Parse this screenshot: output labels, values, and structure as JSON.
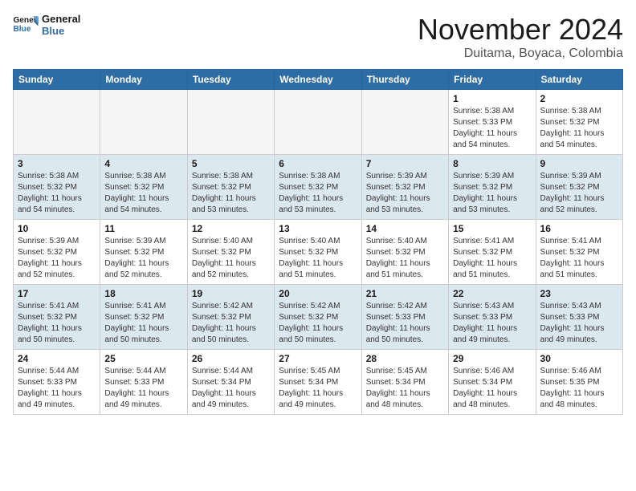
{
  "header": {
    "logo_line1": "General",
    "logo_line2": "Blue",
    "month": "November 2024",
    "location": "Duitama, Boyaca, Colombia"
  },
  "weekdays": [
    "Sunday",
    "Monday",
    "Tuesday",
    "Wednesday",
    "Thursday",
    "Friday",
    "Saturday"
  ],
  "weeks": [
    [
      {
        "day": "",
        "info": ""
      },
      {
        "day": "",
        "info": ""
      },
      {
        "day": "",
        "info": ""
      },
      {
        "day": "",
        "info": ""
      },
      {
        "day": "",
        "info": ""
      },
      {
        "day": "1",
        "info": "Sunrise: 5:38 AM\nSunset: 5:33 PM\nDaylight: 11 hours\nand 54 minutes."
      },
      {
        "day": "2",
        "info": "Sunrise: 5:38 AM\nSunset: 5:32 PM\nDaylight: 11 hours\nand 54 minutes."
      }
    ],
    [
      {
        "day": "3",
        "info": "Sunrise: 5:38 AM\nSunset: 5:32 PM\nDaylight: 11 hours\nand 54 minutes."
      },
      {
        "day": "4",
        "info": "Sunrise: 5:38 AM\nSunset: 5:32 PM\nDaylight: 11 hours\nand 54 minutes."
      },
      {
        "day": "5",
        "info": "Sunrise: 5:38 AM\nSunset: 5:32 PM\nDaylight: 11 hours\nand 53 minutes."
      },
      {
        "day": "6",
        "info": "Sunrise: 5:38 AM\nSunset: 5:32 PM\nDaylight: 11 hours\nand 53 minutes."
      },
      {
        "day": "7",
        "info": "Sunrise: 5:39 AM\nSunset: 5:32 PM\nDaylight: 11 hours\nand 53 minutes."
      },
      {
        "day": "8",
        "info": "Sunrise: 5:39 AM\nSunset: 5:32 PM\nDaylight: 11 hours\nand 53 minutes."
      },
      {
        "day": "9",
        "info": "Sunrise: 5:39 AM\nSunset: 5:32 PM\nDaylight: 11 hours\nand 52 minutes."
      }
    ],
    [
      {
        "day": "10",
        "info": "Sunrise: 5:39 AM\nSunset: 5:32 PM\nDaylight: 11 hours\nand 52 minutes."
      },
      {
        "day": "11",
        "info": "Sunrise: 5:39 AM\nSunset: 5:32 PM\nDaylight: 11 hours\nand 52 minutes."
      },
      {
        "day": "12",
        "info": "Sunrise: 5:40 AM\nSunset: 5:32 PM\nDaylight: 11 hours\nand 52 minutes."
      },
      {
        "day": "13",
        "info": "Sunrise: 5:40 AM\nSunset: 5:32 PM\nDaylight: 11 hours\nand 51 minutes."
      },
      {
        "day": "14",
        "info": "Sunrise: 5:40 AM\nSunset: 5:32 PM\nDaylight: 11 hours\nand 51 minutes."
      },
      {
        "day": "15",
        "info": "Sunrise: 5:41 AM\nSunset: 5:32 PM\nDaylight: 11 hours\nand 51 minutes."
      },
      {
        "day": "16",
        "info": "Sunrise: 5:41 AM\nSunset: 5:32 PM\nDaylight: 11 hours\nand 51 minutes."
      }
    ],
    [
      {
        "day": "17",
        "info": "Sunrise: 5:41 AM\nSunset: 5:32 PM\nDaylight: 11 hours\nand 50 minutes."
      },
      {
        "day": "18",
        "info": "Sunrise: 5:41 AM\nSunset: 5:32 PM\nDaylight: 11 hours\nand 50 minutes."
      },
      {
        "day": "19",
        "info": "Sunrise: 5:42 AM\nSunset: 5:32 PM\nDaylight: 11 hours\nand 50 minutes."
      },
      {
        "day": "20",
        "info": "Sunrise: 5:42 AM\nSunset: 5:32 PM\nDaylight: 11 hours\nand 50 minutes."
      },
      {
        "day": "21",
        "info": "Sunrise: 5:42 AM\nSunset: 5:33 PM\nDaylight: 11 hours\nand 50 minutes."
      },
      {
        "day": "22",
        "info": "Sunrise: 5:43 AM\nSunset: 5:33 PM\nDaylight: 11 hours\nand 49 minutes."
      },
      {
        "day": "23",
        "info": "Sunrise: 5:43 AM\nSunset: 5:33 PM\nDaylight: 11 hours\nand 49 minutes."
      }
    ],
    [
      {
        "day": "24",
        "info": "Sunrise: 5:44 AM\nSunset: 5:33 PM\nDaylight: 11 hours\nand 49 minutes."
      },
      {
        "day": "25",
        "info": "Sunrise: 5:44 AM\nSunset: 5:33 PM\nDaylight: 11 hours\nand 49 minutes."
      },
      {
        "day": "26",
        "info": "Sunrise: 5:44 AM\nSunset: 5:34 PM\nDaylight: 11 hours\nand 49 minutes."
      },
      {
        "day": "27",
        "info": "Sunrise: 5:45 AM\nSunset: 5:34 PM\nDaylight: 11 hours\nand 49 minutes."
      },
      {
        "day": "28",
        "info": "Sunrise: 5:45 AM\nSunset: 5:34 PM\nDaylight: 11 hours\nand 48 minutes."
      },
      {
        "day": "29",
        "info": "Sunrise: 5:46 AM\nSunset: 5:34 PM\nDaylight: 11 hours\nand 48 minutes."
      },
      {
        "day": "30",
        "info": "Sunrise: 5:46 AM\nSunset: 5:35 PM\nDaylight: 11 hours\nand 48 minutes."
      }
    ]
  ]
}
